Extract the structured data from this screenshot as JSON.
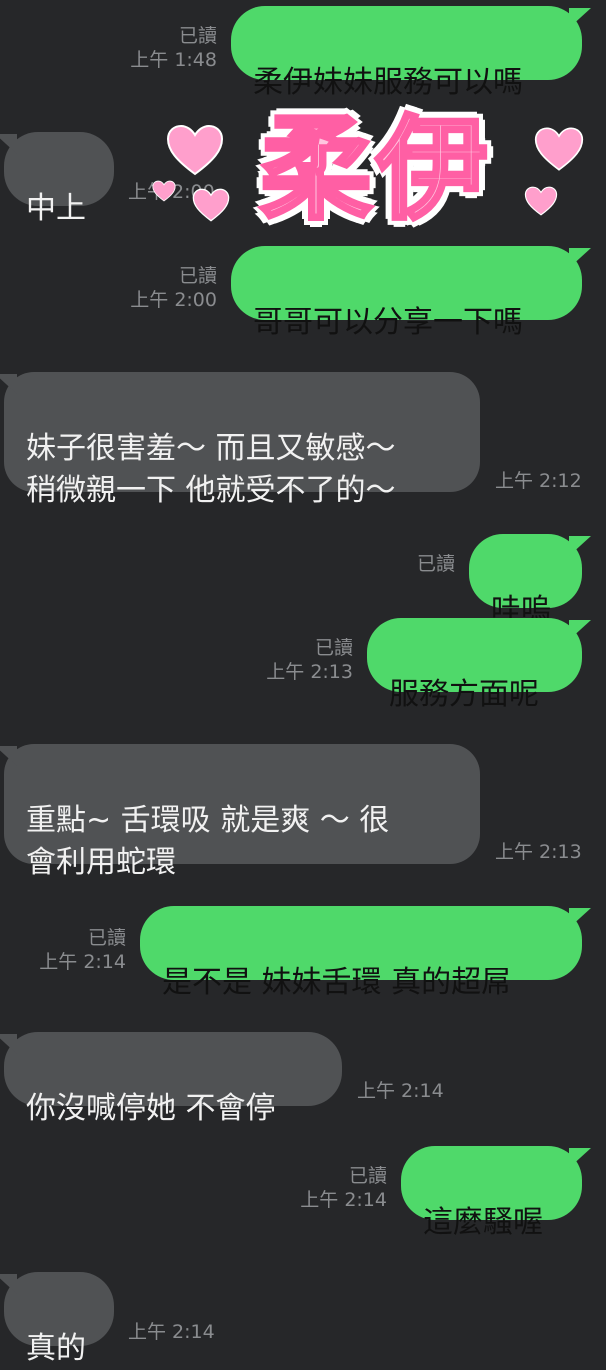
{
  "read_label": "已讀",
  "sticker": {
    "text": "柔伊",
    "heart_color": "#ff8cc4"
  },
  "messages": [
    {
      "dir": "out",
      "text": "柔伊妹妹服務可以嗎",
      "time": "上午 1:48",
      "read": true
    },
    {
      "dir": "in",
      "text": "中上",
      "time": "上午 2:00"
    },
    {
      "dir": "out",
      "text": "哥哥可以分享一下嗎",
      "time": "上午 2:00",
      "read": true
    },
    {
      "dir": "in",
      "text": "妹子很害羞～ 而且又敏感～\n稍微親一下 他就受不了的～",
      "time": "上午 2:12"
    },
    {
      "dir": "out",
      "text": "哇嗚",
      "time": "",
      "read": true
    },
    {
      "dir": "out",
      "text": "服務方面呢",
      "time": "上午 2:13",
      "read": true
    },
    {
      "dir": "in",
      "text": "重點~ 舌環吸 就是爽 ～ 很\n會利用蛇環",
      "time": "上午 2:13"
    },
    {
      "dir": "out",
      "text": "是不是 妹妹舌環 真的超屌",
      "time": "上午 2:14",
      "read": true
    },
    {
      "dir": "in",
      "text": "你沒喊停她 不會停",
      "time": "上午 2:14"
    },
    {
      "dir": "out",
      "text": "這麼騷喔",
      "time": "上午 2:14",
      "read": true
    },
    {
      "dir": "in",
      "text": "真的",
      "time": "上午 2:14"
    }
  ]
}
